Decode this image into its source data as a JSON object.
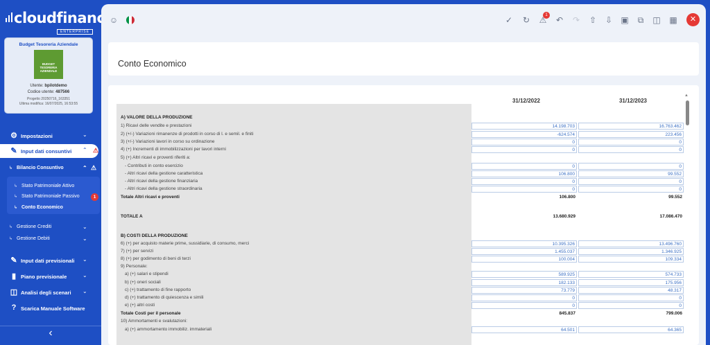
{
  "app": {
    "logo": "cloudfinance",
    "edition": "ENTERPRISE"
  },
  "company_card": {
    "title": "Budget Tesoreria Aziendale",
    "logo_text": "BUDGET TESORERIA AZIENDALE",
    "user_label": "Utente:",
    "user": "bpilotdemo",
    "code_label": "Codice utente:",
    "code": "487566",
    "project_line": "Progetto 20250716_163351",
    "modified_line": "Ultima modifica: 16/07/2025, 16:53:55"
  },
  "nav": {
    "impostazioni": "Impostazioni",
    "input_consuntivi": "Input dati consuntivi",
    "bilancio": "Bilancio Consuntivo",
    "stato_attivo": "Stato Patrimoniale Attivo",
    "stato_passivo": "Stato Patrimoniale Passivo",
    "passivo_badge": "1",
    "conto_economico": "Conto Economico",
    "gestione_crediti": "Gestione Crediti",
    "gestione_debiti": "Gestione Debiti",
    "input_previsionali": "Input dati previsionali",
    "piano": "Piano previsionale",
    "analisi": "Analisi degli scenari",
    "manuale": "Scarica Manuale Software"
  },
  "toolbar": {
    "alert_badge": "1",
    "icons": [
      "palette-icon",
      "flag-it-icon",
      "check-icon",
      "refresh-icon",
      "warning-icon",
      "undo-icon",
      "redo-icon",
      "upload-icon",
      "download-icon",
      "save-icon",
      "copy-icon",
      "columns-icon",
      "calculator-icon",
      "close-icon"
    ]
  },
  "page": {
    "title": "Conto Economico"
  },
  "table": {
    "headers": [
      "31/12/2022",
      "31/12/2023"
    ],
    "rows": [
      {
        "label": "A) VALORE DELLA PRODUZIONE",
        "bold": true
      },
      {
        "label": "1) Ricavi delle vendite e prestazioni",
        "v1": "14.198.703",
        "v2": "16.763.462"
      },
      {
        "label": "2) (+/-) Variazioni rimanenze di prodotti in corso di l. e semil. e finiti",
        "v1": "-624.574",
        "v2": "223.456"
      },
      {
        "label": "3) (+/-) Variazioni lavori in corso su ordinazione",
        "v1": "0",
        "v2": "0"
      },
      {
        "label": "4) (+) Incrementi di immobilizzazioni per lavori interni",
        "v1": "0",
        "v2": "0"
      },
      {
        "label": "5) (+) Altri ricavi e proventi riferiti a:"
      },
      {
        "label": "- Contributi in conto esercizio",
        "v1": "0",
        "v2": "0"
      },
      {
        "label": "- Altri ricavi della gestione caratteristica",
        "v1": "106.800",
        "v2": "99.552"
      },
      {
        "label": "- Altri ricavi della gestione finanziaria",
        "v1": "0",
        "v2": "0"
      },
      {
        "label": "- Altri ricavi della gestione straordinaria",
        "v1": "0",
        "v2": "0"
      },
      {
        "label": "Totale Altri ricavi e proventi",
        "v1": "106.800",
        "v2": "99.552",
        "bold": true
      },
      {
        "label": "TOTALE A",
        "v1": "13.680.929",
        "v2": "17.086.470",
        "bold": true
      },
      {
        "label": "B) COSTI DELLA PRODUZIONE",
        "bold": true
      },
      {
        "label": "6) (+) per acquisto materie prime, sussidiarie, di consumo, merci",
        "v1": "10.395.326",
        "v2": "13.496.760"
      },
      {
        "label": "7) (+) per servizi",
        "v1": "1.455.037",
        "v2": "1.346.925"
      },
      {
        "label": "8) (+) per godimento di beni di terzi",
        "v1": "100.004",
        "v2": "109.334"
      },
      {
        "label": "9) Personale:"
      },
      {
        "label": "a) (+) salari e stipendi",
        "v1": "589.925",
        "v2": "574.733"
      },
      {
        "label": "b) (+) oneri sociali",
        "v1": "182.133",
        "v2": "175.956"
      },
      {
        "label": "c) (+) trattamento di fine rapporto",
        "v1": "73.779",
        "v2": "48.317"
      },
      {
        "label": "d) (+) trattamento di quiescenza e simili",
        "v1": "0",
        "v2": "0"
      },
      {
        "label": "e) (+) altri costi",
        "v1": "0",
        "v2": "0"
      },
      {
        "label": "Totale Costi per il personale",
        "v1": "845.837",
        "v2": "799.006",
        "bold": true
      },
      {
        "label": "10) Ammortamenti e svalutazioni:"
      },
      {
        "label": "a) (+) ammortamento immobiliz. immateriali",
        "v1": "64.501",
        "v2": "64.365"
      }
    ]
  }
}
